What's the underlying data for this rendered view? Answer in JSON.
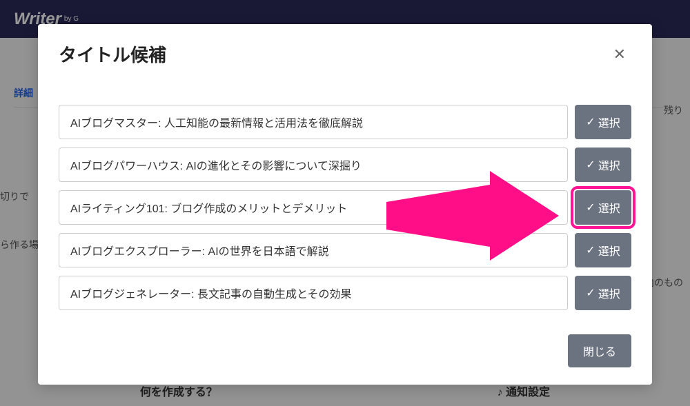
{
  "background": {
    "logo": "Writer",
    "logo_sub": "by G",
    "detail_link": "詳細",
    "partial_left_1": "切りで",
    "partial_left_2": "ら作る場",
    "partial_right_1": "残り",
    "partial_right_2": "国内のもの",
    "bottom_left": "何を作成する？",
    "bottom_right": "♪ 通知設定"
  },
  "modal": {
    "title": "タイトル候補",
    "close_icon": "✕",
    "candidates": [
      {
        "text": "AIブログマスター: 人工知能の最新情報と活用法を徹底解説",
        "highlighted": false
      },
      {
        "text": "AIブログパワーハウス: AIの進化とその影響について深掘り",
        "highlighted": false
      },
      {
        "text": "AIライティング101: ブログ作成のメリットとデメリット",
        "highlighted": true
      },
      {
        "text": "AIブログエクスプローラー: AIの世界を日本語で解説",
        "highlighted": false
      },
      {
        "text": "AIブログジェネレーター: 長文記事の自動生成とその効果",
        "highlighted": false
      }
    ],
    "select_label": "選択",
    "check_glyph": "✓",
    "close_label": "閉じる"
  }
}
